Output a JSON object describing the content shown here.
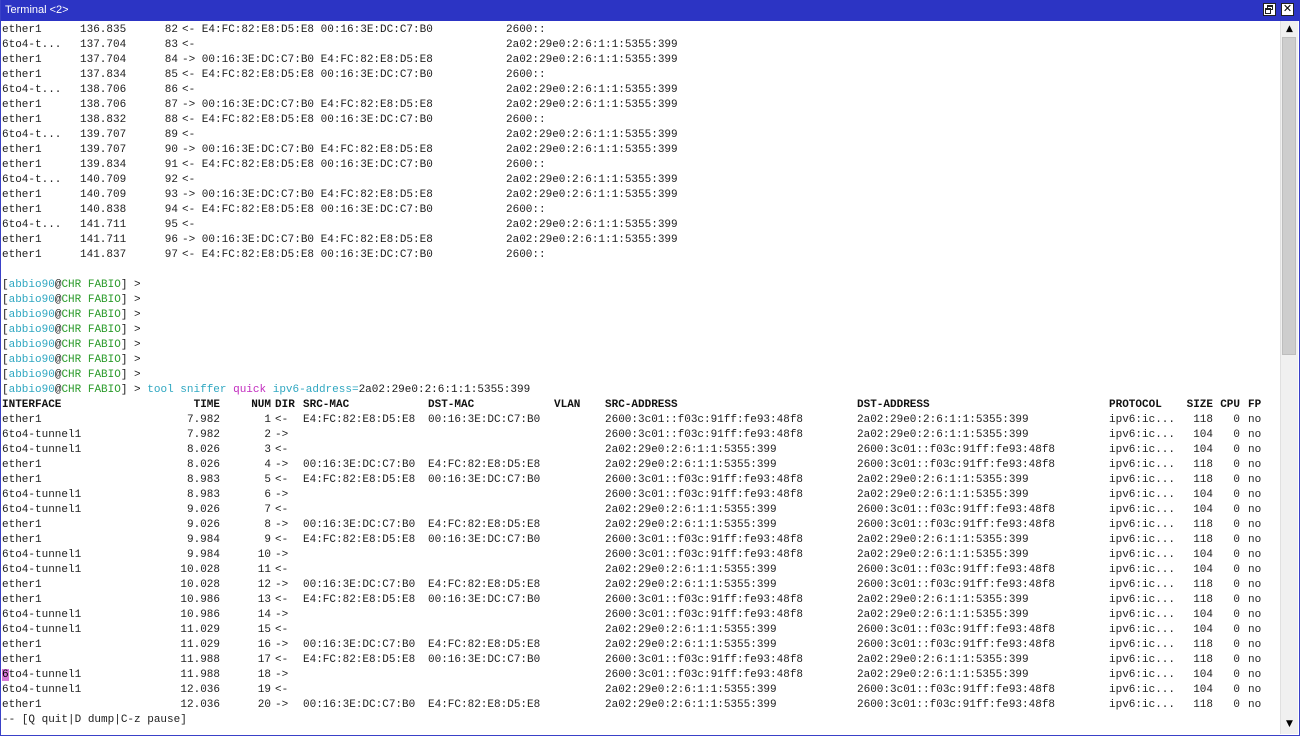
{
  "window": {
    "title": "Terminal <2>"
  },
  "icons": {
    "maximize": "restore-icon",
    "close": "close-icon",
    "scroll_up": "arrow-up-icon",
    "scroll_down": "arrow-down-icon"
  },
  "colors": {
    "titlebar": "#2c34c4",
    "prompt_user": "#2fa7c1",
    "prompt_host": "#2b9b2b",
    "command_arg": "#c22bbf"
  },
  "previous_output": [
    {
      "iface": "ether1",
      "time": "136.835",
      "num": "82",
      "rest": "<- E4:FC:82:E8:D5:E8 00:16:3E:DC:C7:B0",
      "ip": "2600::"
    },
    {
      "iface": "6to4-t...",
      "time": "137.704",
      "num": "83",
      "rest": "<-",
      "ip": "2a02:29e0:2:6:1:1:5355:399"
    },
    {
      "iface": "ether1",
      "time": "137.704",
      "num": "84",
      "rest": "-> 00:16:3E:DC:C7:B0 E4:FC:82:E8:D5:E8",
      "ip": "2a02:29e0:2:6:1:1:5355:399"
    },
    {
      "iface": "ether1",
      "time": "137.834",
      "num": "85",
      "rest": "<- E4:FC:82:E8:D5:E8 00:16:3E:DC:C7:B0",
      "ip": "2600::"
    },
    {
      "iface": "6to4-t...",
      "time": "138.706",
      "num": "86",
      "rest": "<-",
      "ip": "2a02:29e0:2:6:1:1:5355:399"
    },
    {
      "iface": "ether1",
      "time": "138.706",
      "num": "87",
      "rest": "-> 00:16:3E:DC:C7:B0 E4:FC:82:E8:D5:E8",
      "ip": "2a02:29e0:2:6:1:1:5355:399"
    },
    {
      "iface": "ether1",
      "time": "138.832",
      "num": "88",
      "rest": "<- E4:FC:82:E8:D5:E8 00:16:3E:DC:C7:B0",
      "ip": "2600::"
    },
    {
      "iface": "6to4-t...",
      "time": "139.707",
      "num": "89",
      "rest": "<-",
      "ip": "2a02:29e0:2:6:1:1:5355:399"
    },
    {
      "iface": "ether1",
      "time": "139.707",
      "num": "90",
      "rest": "-> 00:16:3E:DC:C7:B0 E4:FC:82:E8:D5:E8",
      "ip": "2a02:29e0:2:6:1:1:5355:399"
    },
    {
      "iface": "ether1",
      "time": "139.834",
      "num": "91",
      "rest": "<- E4:FC:82:E8:D5:E8 00:16:3E:DC:C7:B0",
      "ip": "2600::"
    },
    {
      "iface": "6to4-t...",
      "time": "140.709",
      "num": "92",
      "rest": "<-",
      "ip": "2a02:29e0:2:6:1:1:5355:399"
    },
    {
      "iface": "ether1",
      "time": "140.709",
      "num": "93",
      "rest": "-> 00:16:3E:DC:C7:B0 E4:FC:82:E8:D5:E8",
      "ip": "2a02:29e0:2:6:1:1:5355:399"
    },
    {
      "iface": "ether1",
      "time": "140.838",
      "num": "94",
      "rest": "<- E4:FC:82:E8:D5:E8 00:16:3E:DC:C7:B0",
      "ip": "2600::"
    },
    {
      "iface": "6to4-t...",
      "time": "141.711",
      "num": "95",
      "rest": "<-",
      "ip": "2a02:29e0:2:6:1:1:5355:399"
    },
    {
      "iface": "ether1",
      "time": "141.711",
      "num": "96",
      "rest": "-> 00:16:3E:DC:C7:B0 E4:FC:82:E8:D5:E8",
      "ip": "2a02:29e0:2:6:1:1:5355:399"
    },
    {
      "iface": "ether1",
      "time": "141.837",
      "num": "97",
      "rest": "<- E4:FC:82:E8:D5:E8 00:16:3E:DC:C7:B0",
      "ip": "2600::"
    }
  ],
  "prompt": {
    "open": "[",
    "user": "abbio90",
    "at": "@",
    "host": "CHR FABIO",
    "close": "] >",
    "empty_count": 7
  },
  "command": {
    "part1": "tool sniffer",
    "part2": "quick",
    "part3": "ipv6-address=",
    "part4": "2a02:29e0:2:6:1:1:5355:399"
  },
  "sniffer": {
    "headers": {
      "iface": "INTERFACE",
      "time": "TIME",
      "num": "NUM",
      "dir": "DIR",
      "smac": "SRC-MAC",
      "dmac": "DST-MAC",
      "vlan": "VLAN",
      "sip": "SRC-ADDRESS",
      "dip": "DST-ADDRESS",
      "proto": "PROTOCOL",
      "size": "SIZE",
      "cpu": "CPU",
      "fp": "FP"
    },
    "rows": [
      {
        "iface": "ether1",
        "time": "7.982",
        "num": "1",
        "dir": "<-",
        "smac": "E4:FC:82:E8:D5:E8",
        "dmac": "00:16:3E:DC:C7:B0",
        "sip": "2600:3c01::f03c:91ff:fe93:48f8",
        "dip": "2a02:29e0:2:6:1:1:5355:399",
        "proto": "ipv6:ic...",
        "size": "118",
        "cpu": "0",
        "fp": "no"
      },
      {
        "iface": "6to4-tunnel1",
        "time": "7.982",
        "num": "2",
        "dir": "->",
        "smac": "",
        "dmac": "",
        "sip": "2600:3c01::f03c:91ff:fe93:48f8",
        "dip": "2a02:29e0:2:6:1:1:5355:399",
        "proto": "ipv6:ic...",
        "size": "104",
        "cpu": "0",
        "fp": "no"
      },
      {
        "iface": "6to4-tunnel1",
        "time": "8.026",
        "num": "3",
        "dir": "<-",
        "smac": "",
        "dmac": "",
        "sip": "2a02:29e0:2:6:1:1:5355:399",
        "dip": "2600:3c01::f03c:91ff:fe93:48f8",
        "proto": "ipv6:ic...",
        "size": "104",
        "cpu": "0",
        "fp": "no"
      },
      {
        "iface": "ether1",
        "time": "8.026",
        "num": "4",
        "dir": "->",
        "smac": "00:16:3E:DC:C7:B0",
        "dmac": "E4:FC:82:E8:D5:E8",
        "sip": "2a02:29e0:2:6:1:1:5355:399",
        "dip": "2600:3c01::f03c:91ff:fe93:48f8",
        "proto": "ipv6:ic...",
        "size": "118",
        "cpu": "0",
        "fp": "no"
      },
      {
        "iface": "ether1",
        "time": "8.983",
        "num": "5",
        "dir": "<-",
        "smac": "E4:FC:82:E8:D5:E8",
        "dmac": "00:16:3E:DC:C7:B0",
        "sip": "2600:3c01::f03c:91ff:fe93:48f8",
        "dip": "2a02:29e0:2:6:1:1:5355:399",
        "proto": "ipv6:ic...",
        "size": "118",
        "cpu": "0",
        "fp": "no"
      },
      {
        "iface": "6to4-tunnel1",
        "time": "8.983",
        "num": "6",
        "dir": "->",
        "smac": "",
        "dmac": "",
        "sip": "2600:3c01::f03c:91ff:fe93:48f8",
        "dip": "2a02:29e0:2:6:1:1:5355:399",
        "proto": "ipv6:ic...",
        "size": "104",
        "cpu": "0",
        "fp": "no"
      },
      {
        "iface": "6to4-tunnel1",
        "time": "9.026",
        "num": "7",
        "dir": "<-",
        "smac": "",
        "dmac": "",
        "sip": "2a02:29e0:2:6:1:1:5355:399",
        "dip": "2600:3c01::f03c:91ff:fe93:48f8",
        "proto": "ipv6:ic...",
        "size": "104",
        "cpu": "0",
        "fp": "no"
      },
      {
        "iface": "ether1",
        "time": "9.026",
        "num": "8",
        "dir": "->",
        "smac": "00:16:3E:DC:C7:B0",
        "dmac": "E4:FC:82:E8:D5:E8",
        "sip": "2a02:29e0:2:6:1:1:5355:399",
        "dip": "2600:3c01::f03c:91ff:fe93:48f8",
        "proto": "ipv6:ic...",
        "size": "118",
        "cpu": "0",
        "fp": "no"
      },
      {
        "iface": "ether1",
        "time": "9.984",
        "num": "9",
        "dir": "<-",
        "smac": "E4:FC:82:E8:D5:E8",
        "dmac": "00:16:3E:DC:C7:B0",
        "sip": "2600:3c01::f03c:91ff:fe93:48f8",
        "dip": "2a02:29e0:2:6:1:1:5355:399",
        "proto": "ipv6:ic...",
        "size": "118",
        "cpu": "0",
        "fp": "no"
      },
      {
        "iface": "6to4-tunnel1",
        "time": "9.984",
        "num": "10",
        "dir": "->",
        "smac": "",
        "dmac": "",
        "sip": "2600:3c01::f03c:91ff:fe93:48f8",
        "dip": "2a02:29e0:2:6:1:1:5355:399",
        "proto": "ipv6:ic...",
        "size": "104",
        "cpu": "0",
        "fp": "no"
      },
      {
        "iface": "6to4-tunnel1",
        "time": "10.028",
        "num": "11",
        "dir": "<-",
        "smac": "",
        "dmac": "",
        "sip": "2a02:29e0:2:6:1:1:5355:399",
        "dip": "2600:3c01::f03c:91ff:fe93:48f8",
        "proto": "ipv6:ic...",
        "size": "104",
        "cpu": "0",
        "fp": "no"
      },
      {
        "iface": "ether1",
        "time": "10.028",
        "num": "12",
        "dir": "->",
        "smac": "00:16:3E:DC:C7:B0",
        "dmac": "E4:FC:82:E8:D5:E8",
        "sip": "2a02:29e0:2:6:1:1:5355:399",
        "dip": "2600:3c01::f03c:91ff:fe93:48f8",
        "proto": "ipv6:ic...",
        "size": "118",
        "cpu": "0",
        "fp": "no"
      },
      {
        "iface": "ether1",
        "time": "10.986",
        "num": "13",
        "dir": "<-",
        "smac": "E4:FC:82:E8:D5:E8",
        "dmac": "00:16:3E:DC:C7:B0",
        "sip": "2600:3c01::f03c:91ff:fe93:48f8",
        "dip": "2a02:29e0:2:6:1:1:5355:399",
        "proto": "ipv6:ic...",
        "size": "118",
        "cpu": "0",
        "fp": "no"
      },
      {
        "iface": "6to4-tunnel1",
        "time": "10.986",
        "num": "14",
        "dir": "->",
        "smac": "",
        "dmac": "",
        "sip": "2600:3c01::f03c:91ff:fe93:48f8",
        "dip": "2a02:29e0:2:6:1:1:5355:399",
        "proto": "ipv6:ic...",
        "size": "104",
        "cpu": "0",
        "fp": "no"
      },
      {
        "iface": "6to4-tunnel1",
        "time": "11.029",
        "num": "15",
        "dir": "<-",
        "smac": "",
        "dmac": "",
        "sip": "2a02:29e0:2:6:1:1:5355:399",
        "dip": "2600:3c01::f03c:91ff:fe93:48f8",
        "proto": "ipv6:ic...",
        "size": "104",
        "cpu": "0",
        "fp": "no"
      },
      {
        "iface": "ether1",
        "time": "11.029",
        "num": "16",
        "dir": "->",
        "smac": "00:16:3E:DC:C7:B0",
        "dmac": "E4:FC:82:E8:D5:E8",
        "sip": "2a02:29e0:2:6:1:1:5355:399",
        "dip": "2600:3c01::f03c:91ff:fe93:48f8",
        "proto": "ipv6:ic...",
        "size": "118",
        "cpu": "0",
        "fp": "no"
      },
      {
        "iface": "ether1",
        "time": "11.988",
        "num": "17",
        "dir": "<-",
        "smac": "E4:FC:82:E8:D5:E8",
        "dmac": "00:16:3E:DC:C7:B0",
        "sip": "2600:3c01::f03c:91ff:fe93:48f8",
        "dip": "2a02:29e0:2:6:1:1:5355:399",
        "proto": "ipv6:ic...",
        "size": "118",
        "cpu": "0",
        "fp": "no"
      },
      {
        "iface": "6to4-tunnel1",
        "time": "11.988",
        "num": "18",
        "dir": "->",
        "smac": "",
        "dmac": "",
        "sip": "2600:3c01::f03c:91ff:fe93:48f8",
        "dip": "2a02:29e0:2:6:1:1:5355:399",
        "proto": "ipv6:ic...",
        "size": "104",
        "cpu": "0",
        "fp": "no"
      },
      {
        "iface": "6to4-tunnel1",
        "time": "12.036",
        "num": "19",
        "dir": "<-",
        "smac": "",
        "dmac": "",
        "sip": "2a02:29e0:2:6:1:1:5355:399",
        "dip": "2600:3c01::f03c:91ff:fe93:48f8",
        "proto": "ipv6:ic...",
        "size": "104",
        "cpu": "0",
        "fp": "no"
      },
      {
        "iface": "ether1",
        "time": "12.036",
        "num": "20",
        "dir": "->",
        "smac": "00:16:3E:DC:C7:B0",
        "dmac": "E4:FC:82:E8:D5:E8",
        "sip": "2a02:29e0:2:6:1:1:5355:399",
        "dip": "2600:3c01::f03c:91ff:fe93:48f8",
        "proto": "ipv6:ic...",
        "size": "118",
        "cpu": "0",
        "fp": "no"
      }
    ]
  },
  "status_line": "-- [Q quit|D dump|C-z pause]"
}
